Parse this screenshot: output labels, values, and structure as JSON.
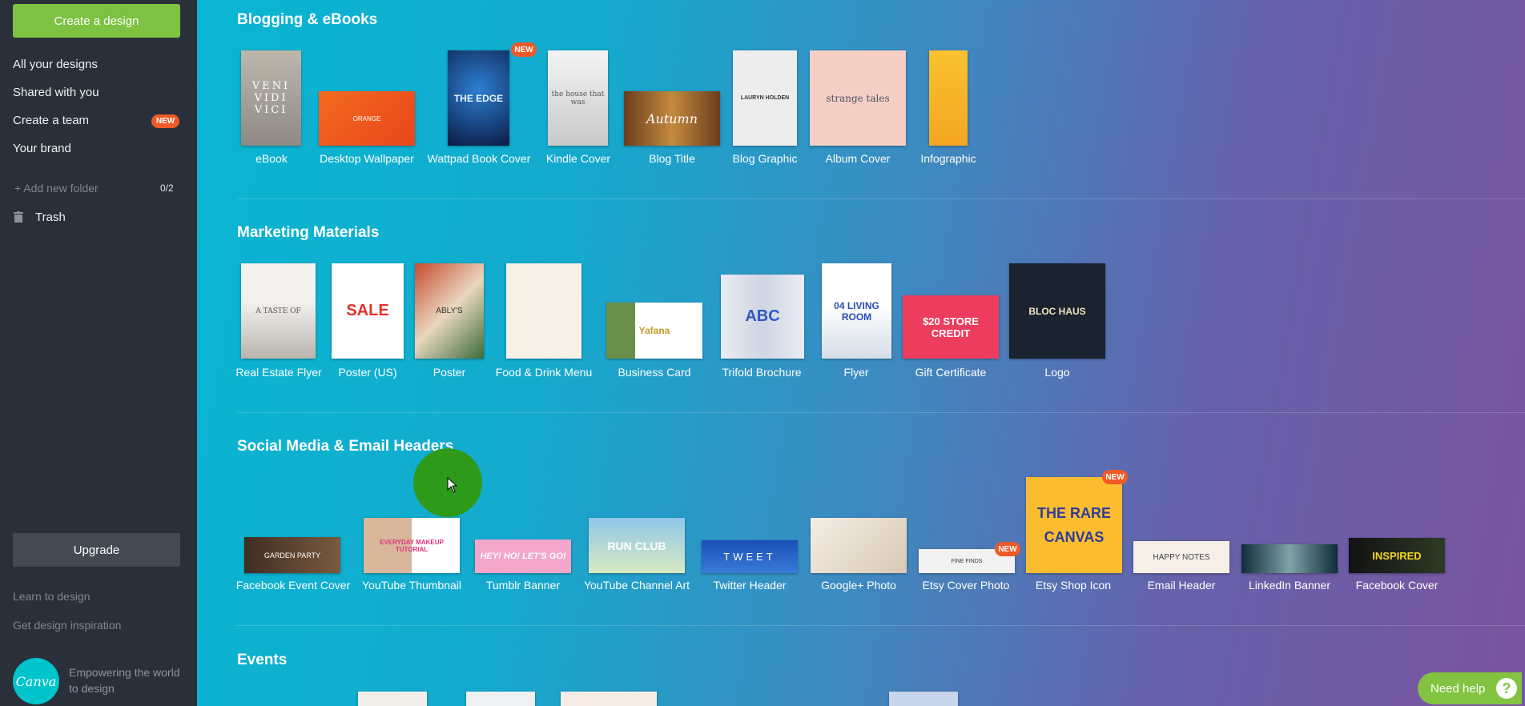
{
  "sidebar": {
    "create_button": "Create a design",
    "items": [
      {
        "label": "All your designs"
      },
      {
        "label": "Shared with you"
      },
      {
        "label": "Create a team",
        "badge": "NEW"
      },
      {
        "label": "Your brand"
      }
    ],
    "add_folder": "+ Add new folder",
    "folder_count": "0/2",
    "trash": "Trash",
    "upgrade": "Upgrade",
    "links": [
      "Learn to design",
      "Get design inspiration"
    ],
    "logo_text": "Canva",
    "tagline": "Empowering the world to design"
  },
  "sections": [
    {
      "title": "Blogging & eBooks",
      "tiles": [
        {
          "label": "eBook",
          "thumb": "VENI VIDI VICI"
        },
        {
          "label": "Desktop Wallpaper",
          "thumb": "ORANGE"
        },
        {
          "label": "Wattpad Book Cover",
          "thumb": "THE EDGE",
          "badge": "NEW"
        },
        {
          "label": "Kindle Cover",
          "thumb": "the house that was"
        },
        {
          "label": "Blog Title",
          "thumb": "Autumn"
        },
        {
          "label": "Blog Graphic",
          "thumb": "LAURYN HOLDEN"
        },
        {
          "label": "Album Cover",
          "thumb": "strange tales"
        },
        {
          "label": "Infographic",
          "thumb": ""
        }
      ]
    },
    {
      "title": "Marketing Materials",
      "tiles": [
        {
          "label": "Real Estate Flyer",
          "thumb": "A TASTE OF"
        },
        {
          "label": "Poster (US)",
          "thumb": "SALE"
        },
        {
          "label": "Poster",
          "thumb": "ABLY'S"
        },
        {
          "label": "Food & Drink Menu",
          "thumb": ""
        },
        {
          "label": "Business Card",
          "thumb": "Yafana"
        },
        {
          "label": "Trifold Brochure",
          "thumb": "ABC"
        },
        {
          "label": "Flyer",
          "thumb": "04 LIVING ROOM"
        },
        {
          "label": "Gift Certificate",
          "thumb": "$20 STORE CREDIT"
        },
        {
          "label": "Logo",
          "thumb": "BLOC HAUS"
        }
      ]
    },
    {
      "title": "Social Media & Email Headers",
      "tiles": [
        {
          "label": "Facebook Event Cover",
          "thumb": "GARDEN PARTY"
        },
        {
          "label": "YouTube Thumbnail",
          "thumb": "EVERYDAY MAKEUP TUTORIAL"
        },
        {
          "label": "Tumblr Banner",
          "thumb": "HEY! HO! LET'S GO!"
        },
        {
          "label": "YouTube Channel Art",
          "thumb": "RUN CLUB"
        },
        {
          "label": "Twitter Header",
          "thumb": "TWEET"
        },
        {
          "label": "Google+ Photo",
          "thumb": ""
        },
        {
          "label": "Etsy Cover Photo",
          "thumb": "FINE FINDS",
          "badge": "NEW"
        },
        {
          "label": "Etsy Shop Icon",
          "thumb": "THE RARE CANVAS",
          "badge": "NEW"
        },
        {
          "label": "Email Header",
          "thumb": "HAPPY NOTES"
        },
        {
          "label": "LinkedIn Banner",
          "thumb": ""
        },
        {
          "label": "Facebook Cover",
          "thumb": "INSPIRED"
        }
      ]
    },
    {
      "title": "Events",
      "tiles": []
    }
  ],
  "help": {
    "label": "Need help",
    "icon": "?"
  }
}
